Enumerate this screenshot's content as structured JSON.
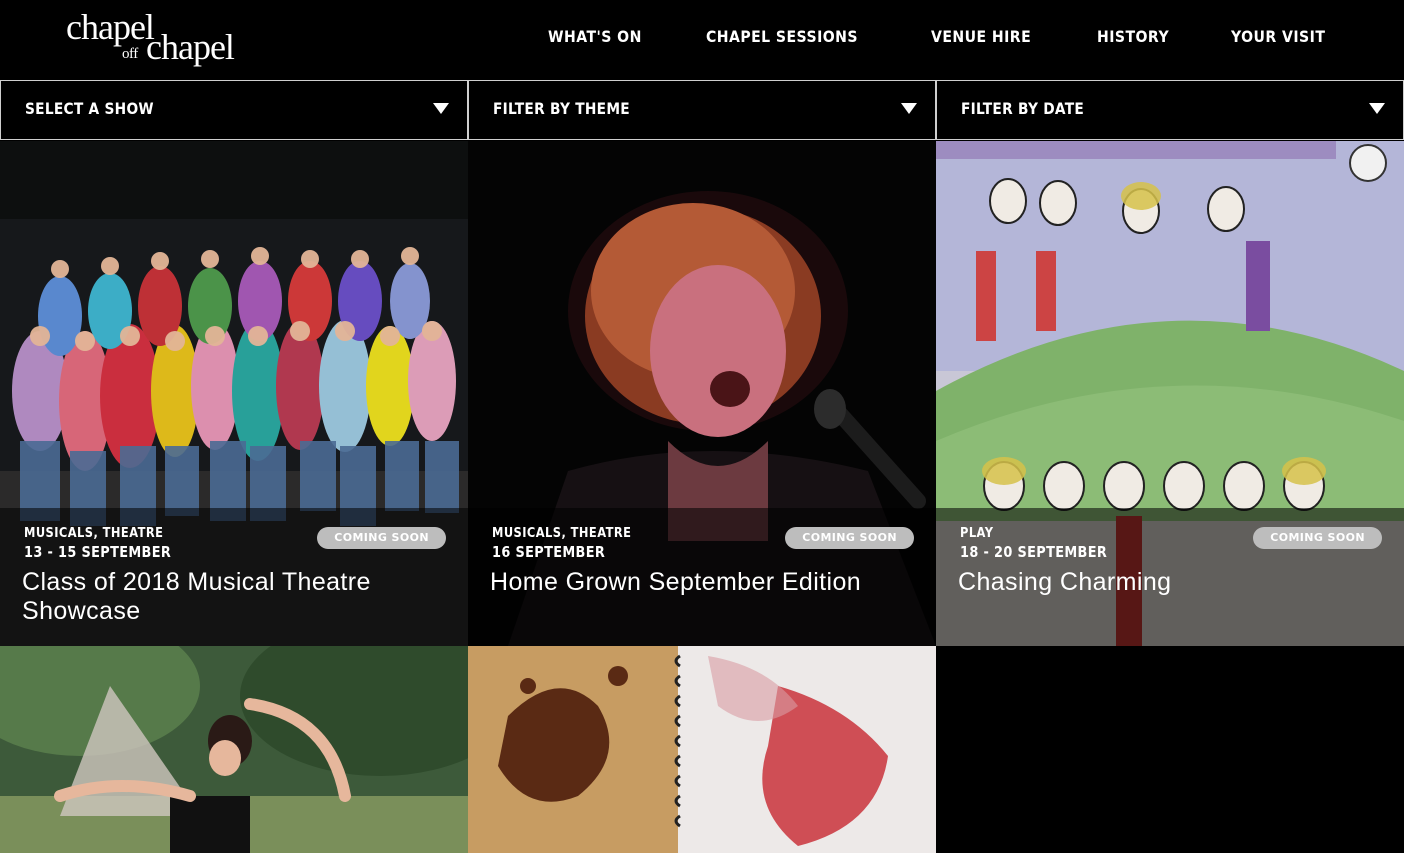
{
  "brand": {
    "logo_parts": [
      "chapel",
      "off",
      "chapel"
    ]
  },
  "nav": {
    "items": [
      "WHAT'S ON",
      "CHAPEL SESSIONS",
      "VENUE HIRE",
      "HISTORY",
      "YOUR VISIT"
    ]
  },
  "filters": {
    "show": "SELECT A SHOW",
    "theme": "FILTER BY THEME",
    "date": "FILTER BY DATE"
  },
  "events": [
    {
      "category": "MUSICALS, THEATRE",
      "date": "13 - 15 SEPTEMBER",
      "badge": "COMING SOON",
      "title": "Class of 2018 Musical Theatre Showcase"
    },
    {
      "category": "MUSICALS, THEATRE",
      "date": "16 SEPTEMBER",
      "badge": "COMING SOON",
      "title": "Home Grown September Edition"
    },
    {
      "category": "PLAY",
      "date": "18 - 20 SEPTEMBER",
      "badge": "COMING SOON",
      "title": "Chasing Charming"
    }
  ],
  "colors": {
    "background": "#000000",
    "badge": "#bdbdbd",
    "filter_border": "#cfcfcf"
  }
}
